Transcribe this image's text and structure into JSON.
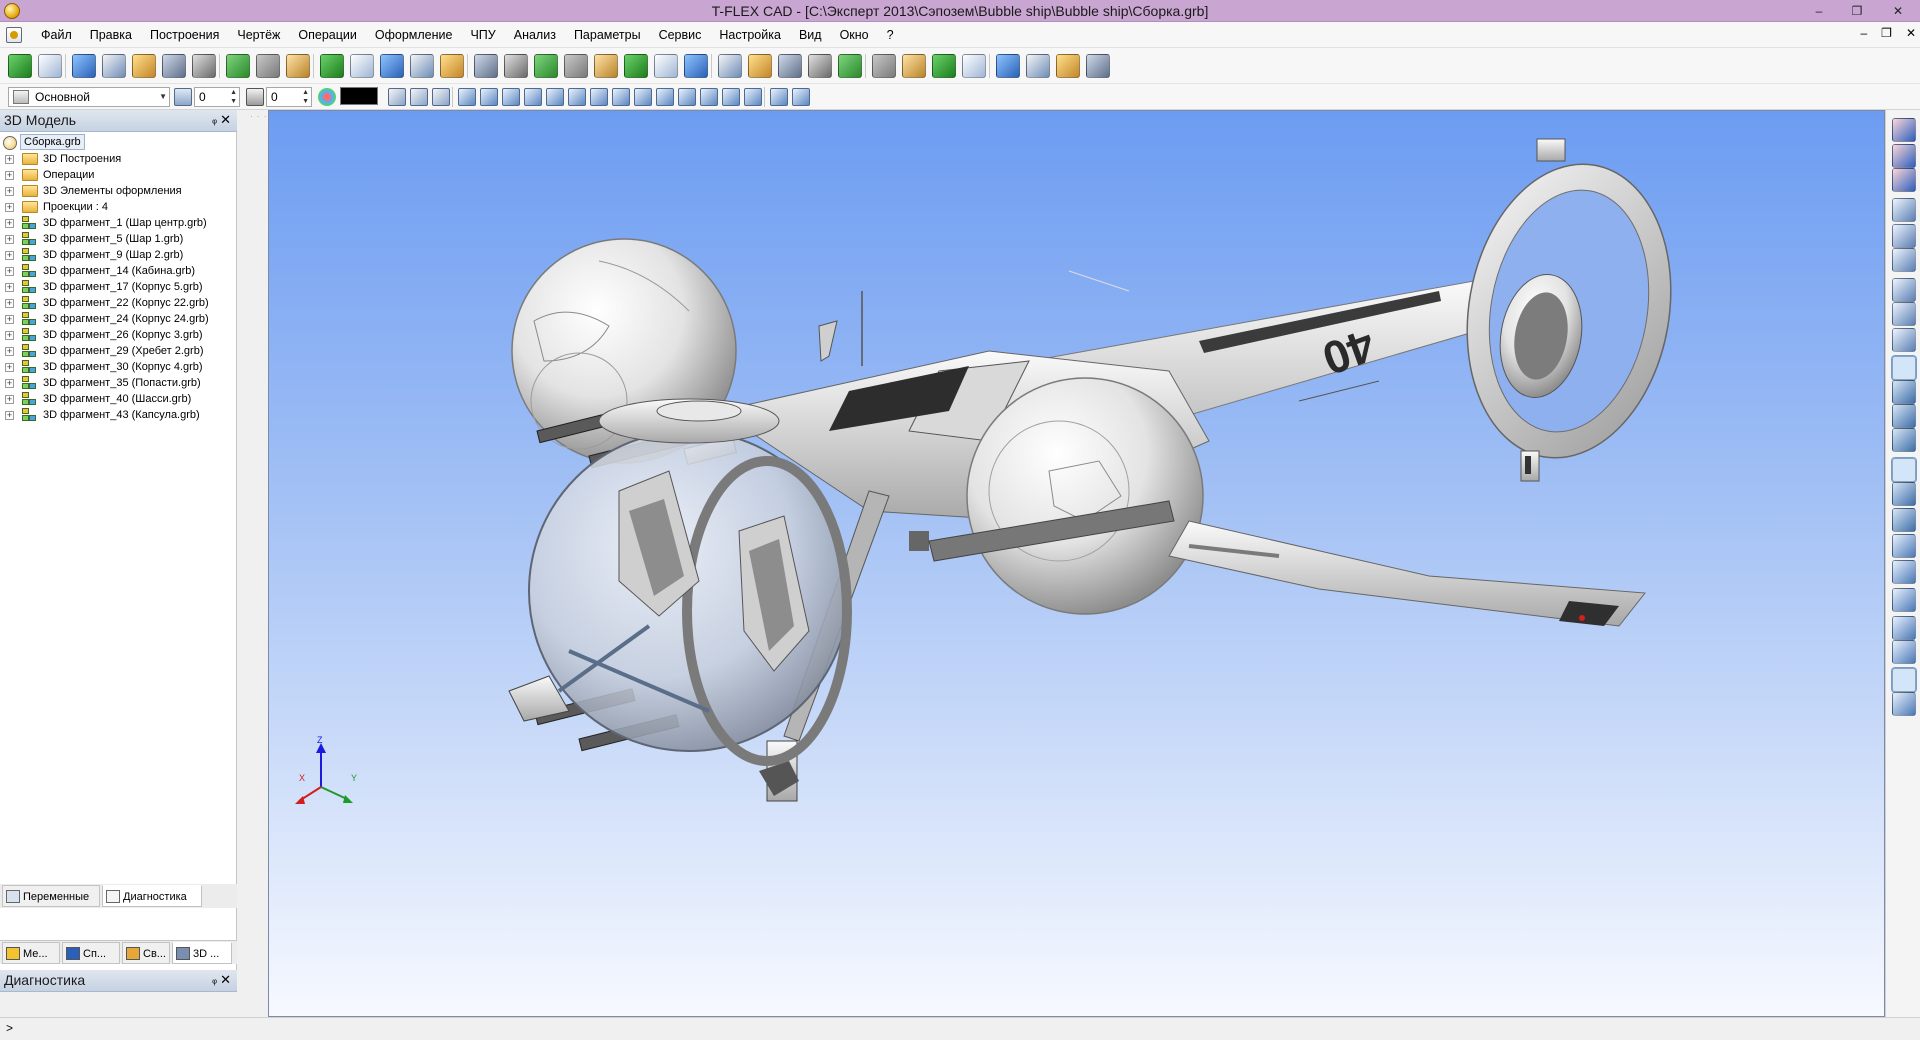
{
  "window": {
    "title": "T-FLEX CAD - [C:\\Эксперт 2013\\Сэпозем\\Bubble ship\\Bubble ship\\Сборка.grb]",
    "controls": {
      "minimize": "–",
      "maximize": "❐",
      "close": "✕"
    },
    "mdi_controls": {
      "minimize": "–",
      "restore": "❐",
      "close": "✕"
    }
  },
  "menu": {
    "items": [
      "Файл",
      "Правка",
      "Построения",
      "Чертёж",
      "Операции",
      "Оформление",
      "ЧПУ",
      "Анализ",
      "Параметры",
      "Сервис",
      "Настройка",
      "Вид",
      "Окно",
      "?"
    ]
  },
  "toolbar2": {
    "layer_combo": "Основной",
    "level_spin": "0",
    "priority_spin": "0"
  },
  "model_panel": {
    "title": "3D Модель",
    "pin": "ᵩ",
    "close": "✕",
    "root": "Сборка.grb",
    "folders": [
      "3D Построения",
      "Операции",
      "3D Элементы оформления",
      "Проекции : 4"
    ],
    "fragments": [
      "3D фрагмент_1 (Шар центр.grb)",
      "3D фрагмент_5 (Шар 1.grb)",
      "3D фрагмент_9 (Шар 2.grb)",
      "3D фрагмент_14 (Кабина.grb)",
      "3D фрагмент_17 (Корпус 5.grb)",
      "3D фрагмент_22 (Корпус 22.grb)",
      "3D фрагмент_24 (Корпус 24.grb)",
      "3D фрагмент_26 (Корпус 3.grb)",
      "3D фрагмент_29 (Хребет 2.grb)",
      "3D фрагмент_30 (Корпус 4.grb)",
      "3D фрагмент_35 (Попасти.grb)",
      "3D фрагмент_40 (Шасси.grb)",
      "3D фрагмент_43 (Капсула.grb)"
    ],
    "tabs": [
      "Ме...",
      "Сп...",
      "Св...",
      "3D ..."
    ]
  },
  "diagnostics_panel": {
    "title": "Диагностика",
    "pin": "ᵩ",
    "close": "✕",
    "tabs": [
      "Переменные",
      "Диагностика"
    ]
  },
  "viewport": {
    "axis_labels": {
      "x": "X",
      "y": "Y",
      "z": "Z"
    },
    "hull_number": "40",
    "colors": {
      "sky_top": "#6c9cf2",
      "sky_bottom": "#f7f9ff",
      "hull": "#e9e9e9",
      "glass": "#c9d2e2"
    }
  },
  "statusbar": {
    "text": ">"
  }
}
